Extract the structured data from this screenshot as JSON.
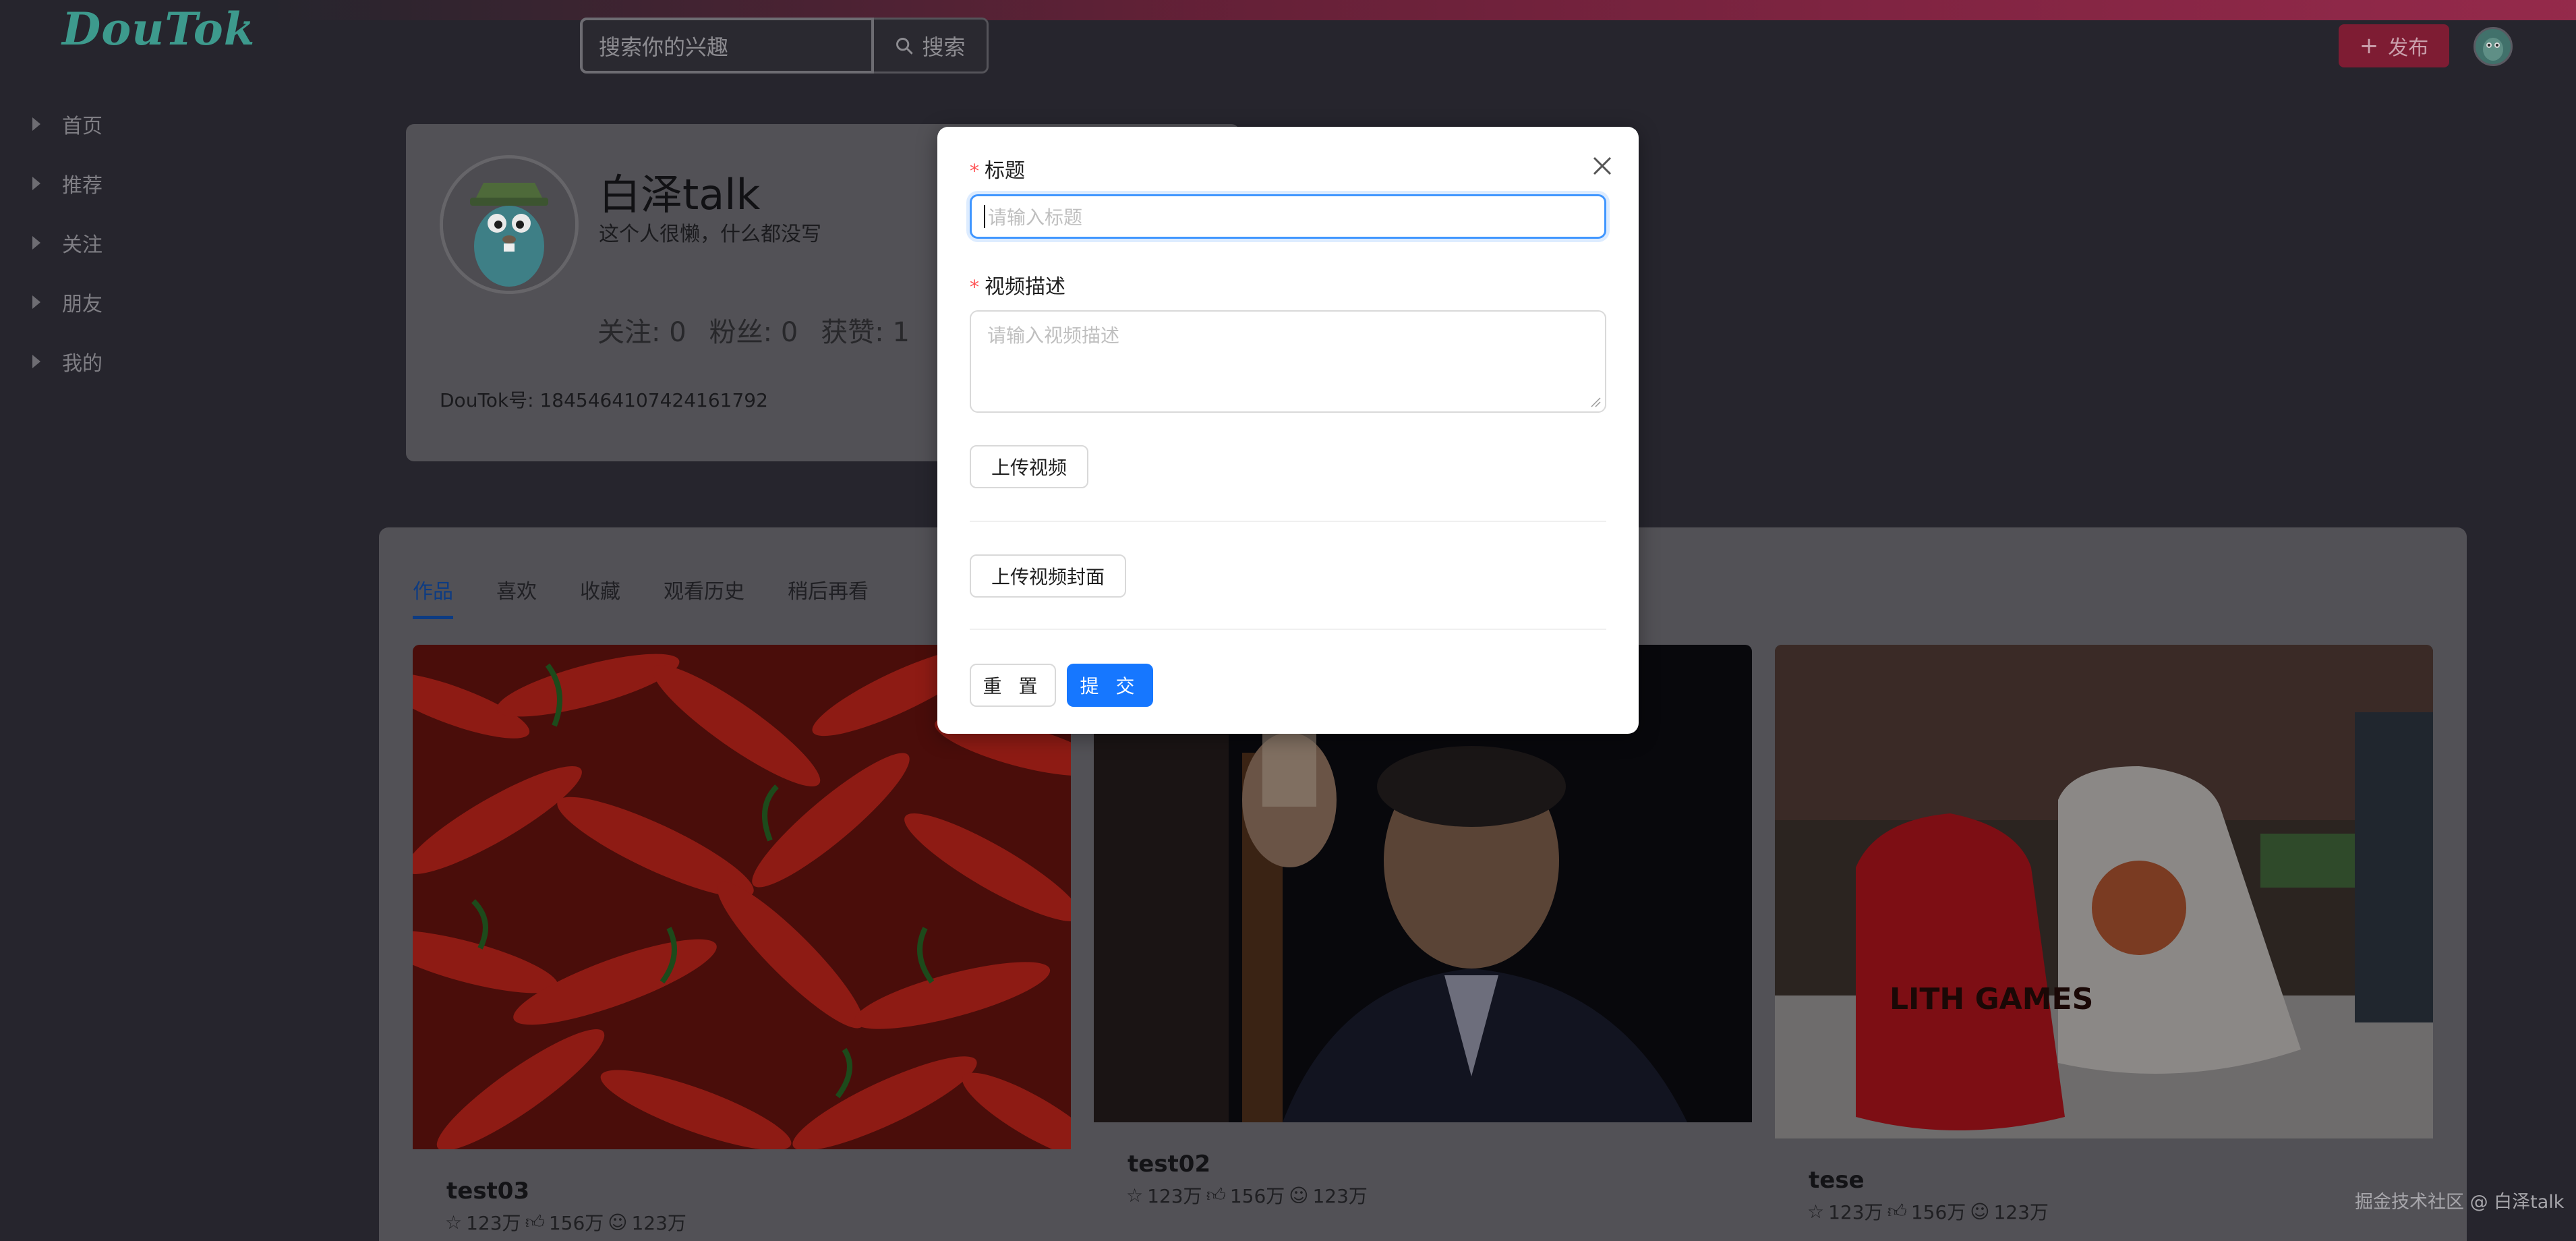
{
  "header": {
    "logo": "DouTok",
    "search_placeholder": "搜索你的兴趣",
    "search_button": "搜索",
    "publish_button": "发布"
  },
  "sidebar": {
    "items": [
      {
        "label": "首页"
      },
      {
        "label": "推荐"
      },
      {
        "label": "关注"
      },
      {
        "label": "朋友"
      },
      {
        "label": "我的"
      }
    ]
  },
  "profile": {
    "name": "白泽talk",
    "bio": "这个人很懒，什么都没写",
    "following": "关注: 0",
    "followers": "粉丝: 0",
    "likes": "获赞: 1",
    "id_text": "DouTok号: 1845464107424161792"
  },
  "tabs": [
    {
      "label": "作品",
      "active": true
    },
    {
      "label": "喜欢"
    },
    {
      "label": "收藏"
    },
    {
      "label": "观看历史"
    },
    {
      "label": "稍后再看"
    }
  ],
  "videos": [
    {
      "title": "test03",
      "stars": "123万",
      "likes": "156万",
      "comments": "123万"
    },
    {
      "title": "test02",
      "stars": "123万",
      "likes": "156万",
      "comments": "123万"
    },
    {
      "title": "tese",
      "stars": "123万",
      "likes": "156万",
      "comments": "123万"
    }
  ],
  "modal": {
    "title_label": "标题",
    "title_placeholder": "请输入标题",
    "desc_label": "视频描述",
    "desc_placeholder": "请输入视频描述",
    "upload_video": "上传视频",
    "upload_cover": "上传视频封面",
    "reset": "重 置",
    "submit": "提 交"
  },
  "watermark": "掘金技术社区 @ 白泽talk",
  "colors": {
    "primary": "#1677ff",
    "required": "#ff4d4f",
    "publish": "#fe2c55"
  }
}
